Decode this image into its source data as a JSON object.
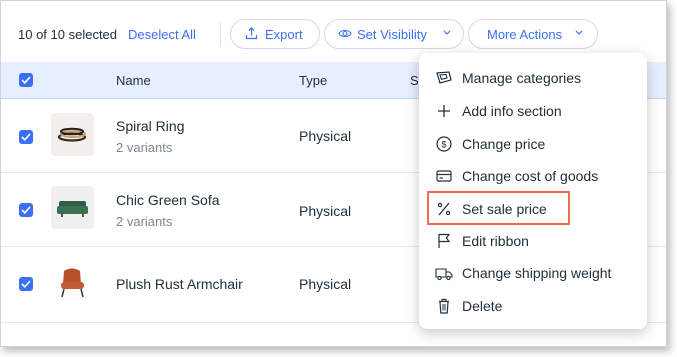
{
  "toolbar": {
    "selection_count": "10 of 10 selected",
    "deselect_all": "Deselect All",
    "export": "Export",
    "set_visibility": "Set Visibility",
    "more_actions": "More Actions"
  },
  "table": {
    "headers": {
      "name": "Name",
      "type": "Type",
      "partial": "S"
    },
    "rows": [
      {
        "name": "Spiral Ring",
        "variants": "2 variants",
        "type": "Physical",
        "checked": true,
        "thumb": "spiral-ring"
      },
      {
        "name": "Chic Green Sofa",
        "variants": "2 variants",
        "type": "Physical",
        "checked": true,
        "thumb": "green-sofa"
      },
      {
        "name": "Plush Rust Armchair",
        "variants": "",
        "type": "Physical",
        "checked": true,
        "thumb": "rust-armchair"
      }
    ]
  },
  "menu": {
    "items": [
      {
        "label": "Manage categories",
        "icon": "categories-icon"
      },
      {
        "label": "Add info section",
        "icon": "plus-icon"
      },
      {
        "label": "Change price",
        "icon": "dollar-circle-icon"
      },
      {
        "label": "Change cost of goods",
        "icon": "credit-card-icon"
      },
      {
        "label": "Set sale price",
        "icon": "percent-icon",
        "highlighted": true
      },
      {
        "label": "Edit ribbon",
        "icon": "flag-icon"
      },
      {
        "label": "Change shipping weight",
        "icon": "truck-icon"
      },
      {
        "label": "Delete",
        "icon": "trash-icon"
      }
    ]
  },
  "colors": {
    "accent": "#3b6ff5",
    "header_bg": "#e6efff",
    "highlight": "#ee6b4d",
    "text": "#20303c",
    "muted": "#7c8792"
  }
}
